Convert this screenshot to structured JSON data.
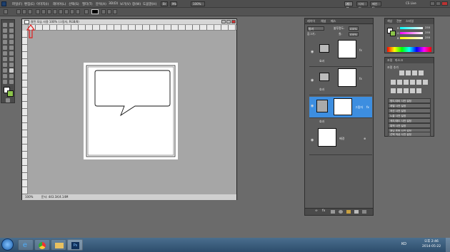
{
  "app": {
    "menu_items": [
      "파일(F)",
      "편집(E)",
      "이미지(I)",
      "레이어(L)",
      "선택(S)",
      "필터(T)",
      "분석(A)",
      "3D(D)",
      "보기(V)",
      "창(W)",
      "도움말(H)"
    ],
    "zoom_label": "100%",
    "workspace": {
      "basic": "기본",
      "design": "디자인",
      "paint": "페인팅"
    },
    "cslive": "CS Live"
  },
  "document": {
    "tab_title": "잘된 모습 사용 100% (그림자, RGB/8)",
    "status_zoom": "100%",
    "status_text": "문서: 443.1K/4.14M"
  },
  "layers_panel": {
    "tabs": [
      "레이어",
      "채널",
      "패스"
    ],
    "blend_mode": "통과",
    "opacity_label": "불투명도:",
    "opacity_value": "100%",
    "fill_label": "칠:",
    "fill_value": "100%",
    "lock_label": "잠그기:",
    "effects_label": "효과",
    "layer_name": "그림자",
    "bg_layer_name": "배경",
    "fx_label": "fx",
    "icons": [
      "link-icon",
      "fx-icon",
      "mask-icon",
      "adjustment-icon",
      "folder-icon",
      "new-layer-icon",
      "trash-icon"
    ]
  },
  "color_panel": {
    "tabs": [
      "색상",
      "견본",
      "스타일"
    ],
    "values": [
      "255",
      "255",
      "255"
    ],
    "labels": [
      "R",
      "G",
      "B"
    ]
  },
  "adjustments_panel": {
    "tabs": [
      "조정",
      "마스크"
    ],
    "title": "조정 추가",
    "presets": [
      "명도/대비 사전 설정",
      "레벨 사전 설정",
      "곡선 사전 설정",
      "노출 사전 설정",
      "색조/채도 사전 설정",
      "흑백 사전 설정",
      "채널 혼합 사전 설정",
      "선택 색상 사전 설정"
    ]
  },
  "taskbar": {
    "time": "오후 2:46",
    "date": "2014-05-22",
    "lang": "KO"
  },
  "colors": {
    "highlight": "#3d8ee0",
    "annotation_arrow": "#e02020"
  }
}
